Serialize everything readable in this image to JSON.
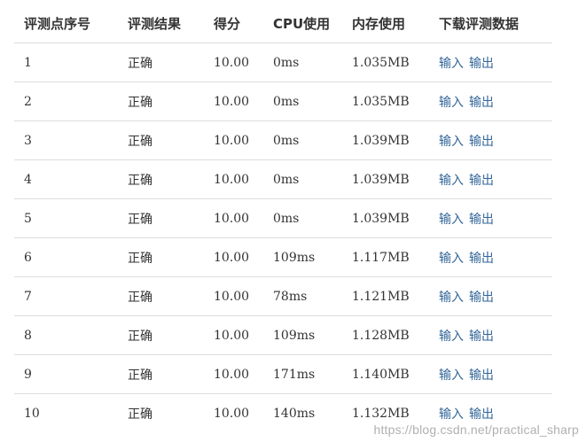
{
  "headers": {
    "index": "评测点序号",
    "result": "评测结果",
    "score": "得分",
    "cpu": "CPU使用",
    "memory": "内存使用",
    "download": "下载评测数据"
  },
  "rows": [
    {
      "index": "1",
      "result": "正确",
      "score": "10.00",
      "cpu": "0ms",
      "memory": "1.035MB",
      "input_label": "输入",
      "output_label": "输出"
    },
    {
      "index": "2",
      "result": "正确",
      "score": "10.00",
      "cpu": "0ms",
      "memory": "1.035MB",
      "input_label": "输入",
      "output_label": "输出"
    },
    {
      "index": "3",
      "result": "正确",
      "score": "10.00",
      "cpu": "0ms",
      "memory": "1.039MB",
      "input_label": "输入",
      "output_label": "输出"
    },
    {
      "index": "4",
      "result": "正确",
      "score": "10.00",
      "cpu": "0ms",
      "memory": "1.039MB",
      "input_label": "输入",
      "output_label": "输出"
    },
    {
      "index": "5",
      "result": "正确",
      "score": "10.00",
      "cpu": "0ms",
      "memory": "1.039MB",
      "input_label": "输入",
      "output_label": "输出"
    },
    {
      "index": "6",
      "result": "正确",
      "score": "10.00",
      "cpu": "109ms",
      "memory": "1.117MB",
      "input_label": "输入",
      "output_label": "输出"
    },
    {
      "index": "7",
      "result": "正确",
      "score": "10.00",
      "cpu": "78ms",
      "memory": "1.121MB",
      "input_label": "输入",
      "output_label": "输出"
    },
    {
      "index": "8",
      "result": "正确",
      "score": "10.00",
      "cpu": "109ms",
      "memory": "1.128MB",
      "input_label": "输入",
      "output_label": "输出"
    },
    {
      "index": "9",
      "result": "正确",
      "score": "10.00",
      "cpu": "171ms",
      "memory": "1.140MB",
      "input_label": "输入",
      "output_label": "输出"
    },
    {
      "index": "10",
      "result": "正确",
      "score": "10.00",
      "cpu": "140ms",
      "memory": "1.132MB",
      "input_label": "输入",
      "output_label": "输出"
    }
  ],
  "watermark": "https://blog.csdn.net/practical_sharp",
  "colors": {
    "link": "#336699",
    "text": "#333333",
    "divider": "#dddddd"
  }
}
